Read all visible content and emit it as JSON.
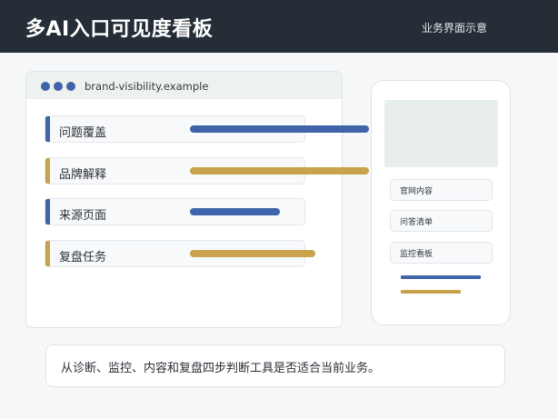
{
  "header": {
    "title": "多AI入口可见度看板",
    "subtitle": "业务界面示意"
  },
  "browser": {
    "url": "brand-visibility.example",
    "rows": [
      {
        "label": "问题覆盖",
        "color": "#3f64aa",
        "level": 1.0
      },
      {
        "label": "品牌解释",
        "color": "#c9a24e",
        "level": 1.0
      },
      {
        "label": "来源页面",
        "color": "#3f64aa",
        "level": 0.5
      },
      {
        "label": "复盘任务",
        "color": "#c9a24e",
        "level": 0.7
      }
    ]
  },
  "phone": {
    "items": [
      {
        "label": "官网内容"
      },
      {
        "label": "问答清单"
      },
      {
        "label": "监控看板"
      }
    ]
  },
  "caption": {
    "text": "从诊断、监控、内容和复盘四步判断工具是否适合当前业务。"
  },
  "colors": {
    "header_bg": "#252e37",
    "accent_blue": "#3f64aa",
    "accent_gold": "#c9a24e"
  }
}
